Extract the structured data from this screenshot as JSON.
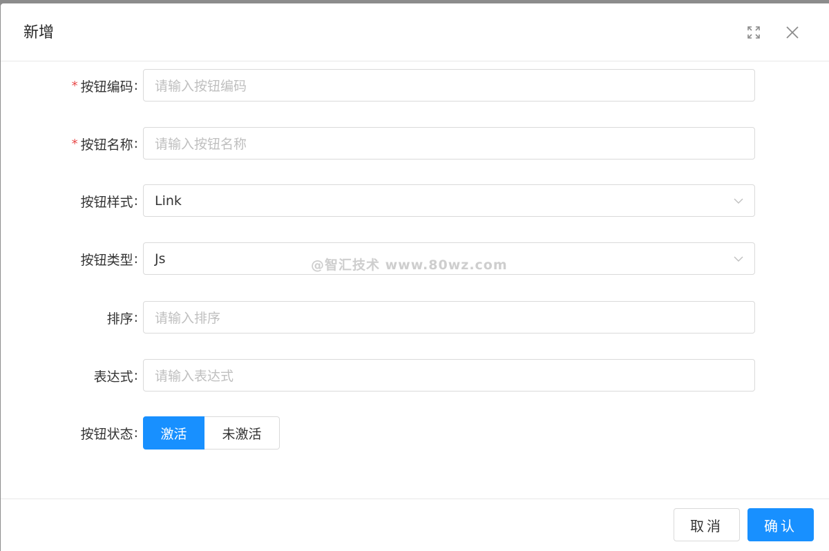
{
  "modal": {
    "title": "新增"
  },
  "form": {
    "button_code": {
      "label": "按钮编码",
      "placeholder": "请输入按钮编码",
      "required": true
    },
    "button_name": {
      "label": "按钮名称",
      "placeholder": "请输入按钮名称",
      "required": true
    },
    "button_style": {
      "label": "按钮样式",
      "value": "Link"
    },
    "button_type": {
      "label": "按钮类型",
      "value": "Js"
    },
    "sort": {
      "label": "排序",
      "placeholder": "请输入排序"
    },
    "expression": {
      "label": "表达式",
      "placeholder": "请输入表达式"
    },
    "button_status": {
      "label": "按钮状态",
      "options": [
        "激活",
        "未激活"
      ],
      "selected": "激活"
    },
    "required_mark": "*",
    "colon": ":"
  },
  "watermark": "@智汇技术 www.80wz.com",
  "footer": {
    "cancel_label": "取消",
    "ok_label": "确认"
  },
  "colors": {
    "primary": "#1890ff",
    "required": "#e84a4a"
  },
  "icons": {
    "fullscreen": "fullscreen-icon",
    "close": "close-icon",
    "select_arrow": "chevron-down-icon"
  }
}
